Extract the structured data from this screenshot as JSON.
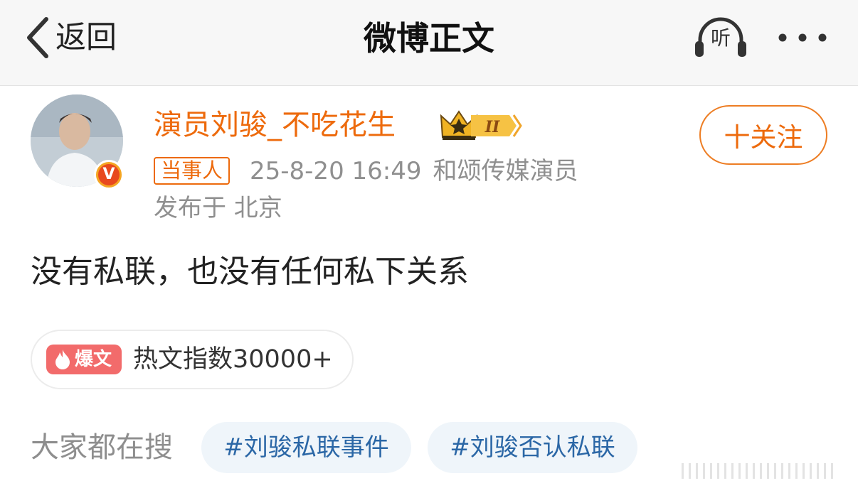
{
  "nav": {
    "back_label": "返回",
    "title": "微博正文",
    "listen_label": "听",
    "back_icon": "chevron-left-icon",
    "more_icon": "more-dots-icon"
  },
  "post": {
    "author": {
      "name": "演员刘骏_不吃花生",
      "verified_label": "V",
      "level": "II"
    },
    "follow_label": "十关注",
    "tag": "当事人",
    "timestamp": "25-8-20 16:49",
    "source": "和颂传媒演员",
    "location": "发布于 北京",
    "content": "没有私联，也没有任何私下关系"
  },
  "hot": {
    "badge_label": "爆文",
    "text": "热文指数30000+"
  },
  "search": {
    "label": "大家都在搜",
    "chips": [
      "#刘骏私联事件",
      "#刘骏否认私联"
    ]
  },
  "colors": {
    "accent_orange": "#ed6a0c",
    "link_blue": "#2b67a6",
    "chip_bg": "#eff5fa",
    "hot_red": "#f26b6b"
  }
}
